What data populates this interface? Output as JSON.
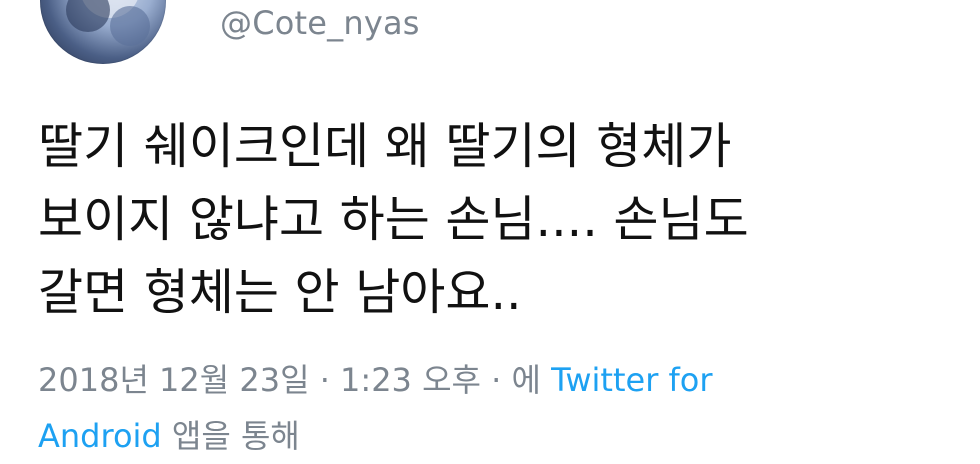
{
  "user": {
    "handle": "@Cote_nyas",
    "avatar_icon": "profile-photo"
  },
  "tweet": {
    "lines": [
      "딸기 쉐이크인데 왜 딸기의 형체가",
      "보이지 않냐고 하는 손님.... 손님도",
      "갈면 형체는 안 남아요.."
    ]
  },
  "meta": {
    "timestamp": "2018년 12월 23일 · 1:23 오후 · 에",
    "source_link_part1": "Twitter for",
    "source_link_part2": "Android",
    "suffix": "앱을 통해"
  },
  "colors": {
    "text": "#111111",
    "secondary": "#7c858f",
    "link": "#1da1f2"
  }
}
